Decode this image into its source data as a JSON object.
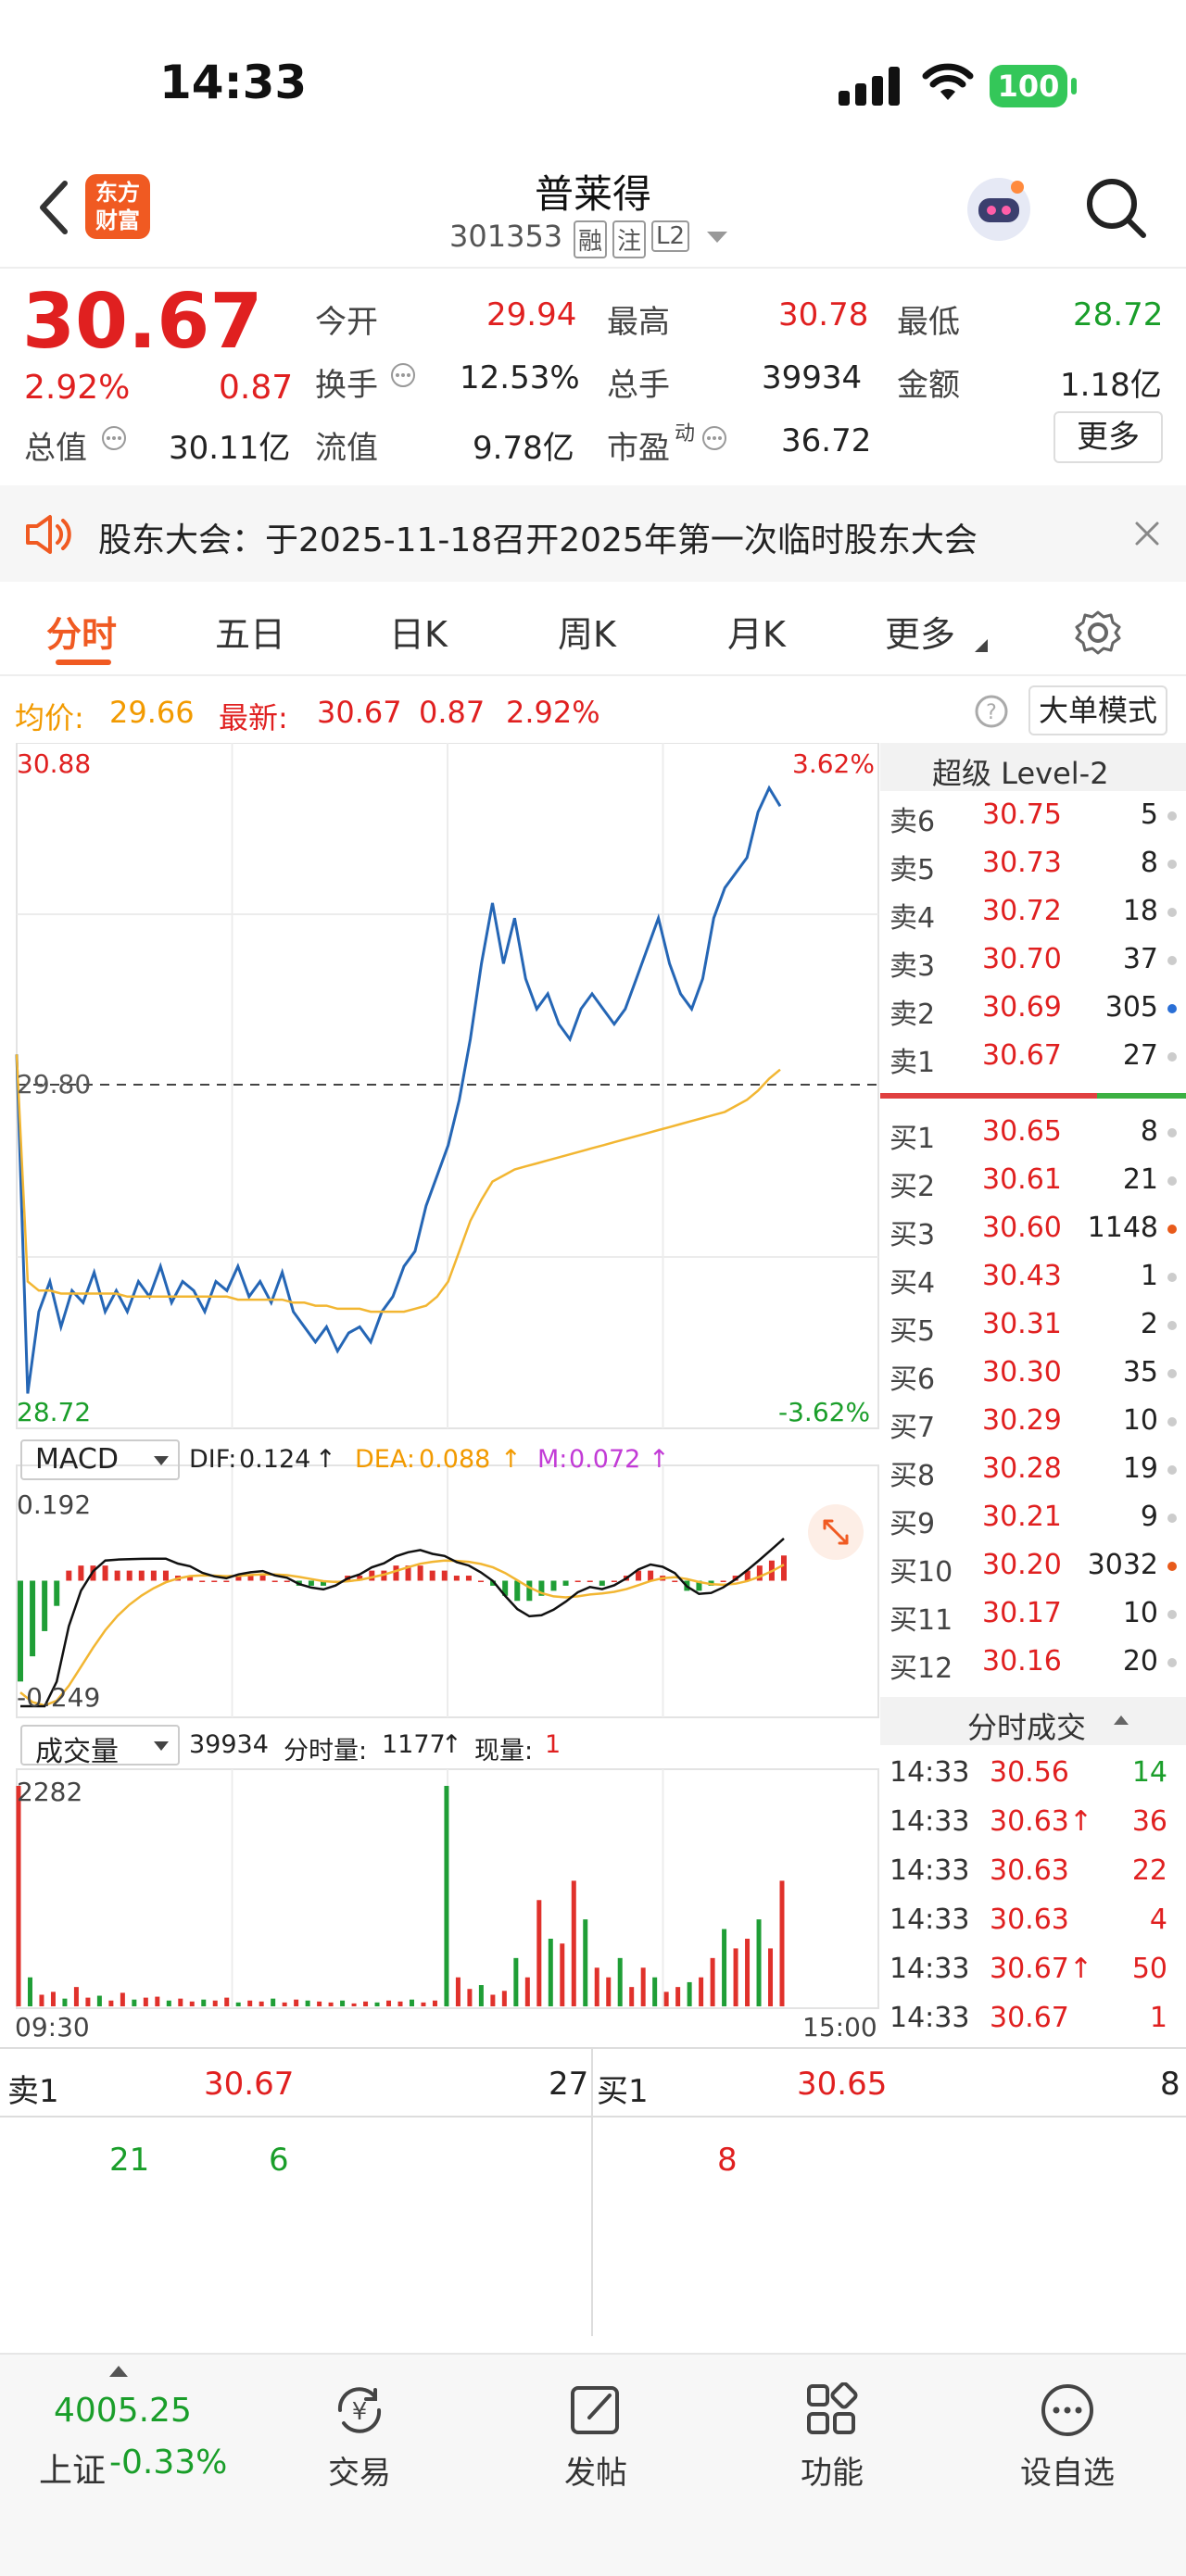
{
  "status": {
    "time": "14:33",
    "battery": "100"
  },
  "nav": {
    "logo_line1": "东方",
    "logo_line2": "财富",
    "name": "普莱得",
    "code": "301353",
    "badges": [
      "融",
      "注",
      "L2"
    ]
  },
  "quote": {
    "price": "30.67",
    "pct": "2.92%",
    "chg": "0.87",
    "open_label": "今开",
    "open": "29.94",
    "high_label": "最高",
    "high": "30.78",
    "low_label": "最低",
    "low": "28.72",
    "turnover_label": "换手",
    "turnover": "12.53%",
    "vol_label": "总手",
    "vol": "39934",
    "amount_label": "金额",
    "amount": "1.18亿",
    "mktcap_label": "总值",
    "mktcap": "30.11亿",
    "float_label": "流值",
    "float": "9.78亿",
    "pe_label": "市盈",
    "pe_sup": "动",
    "pe": "36.72",
    "more": "更多"
  },
  "notice": {
    "text": "股东大会：于2025-11-18召开2025年第一次临时股东大会"
  },
  "tabs": [
    "分时",
    "五日",
    "日K",
    "周K",
    "月K",
    "更多"
  ],
  "avg": {
    "avg_label": "均价:",
    "avg": "29.66",
    "last_label": "最新:",
    "last": "30.67",
    "chg": "0.87",
    "pct": "2.92%",
    "mode": "大单模式"
  },
  "chart_data": [
    {
      "type": "line",
      "title": "",
      "y_top_label": "30.88",
      "y_mid_label": "29.80",
      "y_bottom_label": "28.72",
      "pct_top_label": "3.62%",
      "pct_bottom_label": "-3.62%",
      "ylim": [
        28.72,
        30.88
      ],
      "prev_close": 29.8,
      "x_start": "09:30",
      "x_end": "15:00",
      "series": [
        {
          "name": "最新",
          "color": "#2566b5",
          "values": [
            29.9,
            28.78,
            29.05,
            29.15,
            29.0,
            29.12,
            29.08,
            29.18,
            29.05,
            29.12,
            29.05,
            29.15,
            29.1,
            29.2,
            29.08,
            29.15,
            29.12,
            29.05,
            29.15,
            29.12,
            29.2,
            29.1,
            29.15,
            29.08,
            29.18,
            29.05,
            29.0,
            28.95,
            29.0,
            28.92,
            28.98,
            29.0,
            28.95,
            29.05,
            29.1,
            29.2,
            29.25,
            29.4,
            29.5,
            29.6,
            29.75,
            29.95,
            30.2,
            30.4,
            30.2,
            30.35,
            30.15,
            30.05,
            30.1,
            30.0,
            29.95,
            30.05,
            30.1,
            30.05,
            30.0,
            30.05,
            30.15,
            30.25,
            30.35,
            30.2,
            30.1,
            30.05,
            30.15,
            30.35,
            30.45,
            30.5,
            30.55,
            30.7,
            30.78,
            30.72
          ]
        },
        {
          "name": "均价",
          "color": "#f2b632",
          "values": [
            29.9,
            29.15,
            29.12,
            29.12,
            29.11,
            29.11,
            29.11,
            29.11,
            29.11,
            29.11,
            29.1,
            29.1,
            29.1,
            29.1,
            29.1,
            29.1,
            29.1,
            29.1,
            29.1,
            29.1,
            29.09,
            29.09,
            29.09,
            29.09,
            29.09,
            29.08,
            29.08,
            29.07,
            29.07,
            29.06,
            29.06,
            29.06,
            29.05,
            29.05,
            29.05,
            29.05,
            29.06,
            29.07,
            29.1,
            29.15,
            29.25,
            29.35,
            29.42,
            29.48,
            29.5,
            29.52,
            29.53,
            29.54,
            29.55,
            29.56,
            29.57,
            29.58,
            29.59,
            29.6,
            29.61,
            29.62,
            29.63,
            29.64,
            29.65,
            29.66,
            29.67,
            29.68,
            29.69,
            29.7,
            29.71,
            29.73,
            29.75,
            29.78,
            29.82,
            29.85
          ]
        }
      ]
    },
    {
      "type": "bar",
      "title": "MACD",
      "dif": "0.124",
      "dea": "0.088",
      "m": "0.072",
      "y_top_label": "0.192",
      "y_bottom_label": "-0.249",
      "ylim": [
        -0.249,
        0.192
      ],
      "values": [
        -0.2,
        -0.15,
        -0.1,
        -0.05,
        0.02,
        0.03,
        0.03,
        0.03,
        0.02,
        0.02,
        0.02,
        0.02,
        0.02,
        0.01,
        0.01,
        0.0,
        0.0,
        0.0,
        0.01,
        0.01,
        0.01,
        0.0,
        0.0,
        -0.01,
        -0.01,
        -0.01,
        0.0,
        0.01,
        0.01,
        0.02,
        0.02,
        0.03,
        0.03,
        0.03,
        0.02,
        0.02,
        0.01,
        0.01,
        0.0,
        -0.01,
        -0.03,
        -0.04,
        -0.04,
        -0.03,
        -0.02,
        -0.01,
        0.0,
        0.0,
        -0.01,
        0.0,
        0.01,
        0.02,
        0.02,
        0.01,
        0.0,
        -0.02,
        -0.02,
        -0.01,
        0.0,
        0.01,
        0.02,
        0.03,
        0.04,
        0.05
      ]
    },
    {
      "type": "bar",
      "title": "成交量",
      "total": "39934",
      "minute_label": "分时量:",
      "minute": "1177",
      "now_label": "现量:",
      "now": "1",
      "y_top_label": "2282",
      "ylim": [
        0,
        2282
      ],
      "values": [
        2282,
        300,
        120,
        150,
        80,
        200,
        90,
        110,
        60,
        140,
        70,
        90,
        100,
        60,
        80,
        50,
        70,
        60,
        90,
        40,
        60,
        50,
        80,
        40,
        70,
        60,
        50,
        40,
        60,
        30,
        50,
        40,
        60,
        50,
        70,
        40,
        60,
        2282,
        300,
        180,
        220,
        120,
        160,
        500,
        300,
        1100,
        700,
        650,
        1300,
        900,
        400,
        300,
        500,
        200,
        400,
        300,
        150,
        200,
        250,
        300,
        500,
        800,
        600,
        700,
        900,
        600,
        1300
      ]
    }
  ],
  "level2": {
    "title": "超级 Level-2",
    "asks": [
      {
        "label": "卖6",
        "price": "30.75",
        "vol": "5",
        "dot": "#cccccc"
      },
      {
        "label": "卖5",
        "price": "30.73",
        "vol": "8",
        "dot": "#cccccc"
      },
      {
        "label": "卖4",
        "price": "30.72",
        "vol": "18",
        "dot": "#cccccc"
      },
      {
        "label": "卖3",
        "price": "30.70",
        "vol": "37",
        "dot": "#cccccc"
      },
      {
        "label": "卖2",
        "price": "30.69",
        "vol": "305",
        "dot": "#2a6fd6"
      },
      {
        "label": "卖1",
        "price": "30.67",
        "vol": "27",
        "dot": "#cccccc"
      }
    ],
    "bids": [
      {
        "label": "买1",
        "price": "30.65",
        "vol": "8",
        "dot": "#cccccc"
      },
      {
        "label": "买2",
        "price": "30.61",
        "vol": "21",
        "dot": "#cccccc"
      },
      {
        "label": "买3",
        "price": "30.60",
        "vol": "1148",
        "dot": "#e85a1a"
      },
      {
        "label": "买4",
        "price": "30.43",
        "vol": "1",
        "dot": "#cccccc"
      },
      {
        "label": "买5",
        "price": "30.31",
        "vol": "2",
        "dot": "#cccccc"
      },
      {
        "label": "买6",
        "price": "30.30",
        "vol": "35",
        "dot": "#cccccc"
      },
      {
        "label": "买7",
        "price": "30.29",
        "vol": "10",
        "dot": "#cccccc"
      },
      {
        "label": "买8",
        "price": "30.28",
        "vol": "19",
        "dot": "#cccccc"
      },
      {
        "label": "买9",
        "price": "30.21",
        "vol": "9",
        "dot": "#cccccc"
      },
      {
        "label": "买10",
        "price": "30.20",
        "vol": "3032",
        "dot": "#e85a1a"
      },
      {
        "label": "买11",
        "price": "30.17",
        "vol": "10",
        "dot": "#cccccc"
      },
      {
        "label": "买12",
        "price": "30.16",
        "vol": "20",
        "dot": "#cccccc"
      }
    ],
    "ticks_title": "分时成交",
    "ticks": [
      {
        "time": "14:33",
        "price": "30.56",
        "vol": "14",
        "vol_color": "#1a9e2a"
      },
      {
        "time": "14:33",
        "price": "30.63↑",
        "vol": "36",
        "vol_color": "#e02020"
      },
      {
        "time": "14:33",
        "price": "30.63",
        "vol": "22",
        "vol_color": "#e02020"
      },
      {
        "time": "14:33",
        "price": "30.63",
        "vol": "4",
        "vol_color": "#e02020"
      },
      {
        "time": "14:33",
        "price": "30.67↑",
        "vol": "50",
        "vol_color": "#e02020"
      },
      {
        "time": "14:33",
        "price": "30.67",
        "vol": "1",
        "vol_color": "#e02020"
      }
    ]
  },
  "book": {
    "ask_label": "卖1",
    "ask_price": "30.67",
    "ask_vol": "27",
    "bid_label": "买1",
    "bid_price": "30.65",
    "bid_vol": "8",
    "ask_q1": "21",
    "ask_q2": "6",
    "bid_q1": "8"
  },
  "tabbar": {
    "index_value": "4005.25",
    "index_name": "上证",
    "index_pct": "-0.33%",
    "items": [
      "交易",
      "发帖",
      "功能",
      "设自选"
    ]
  }
}
